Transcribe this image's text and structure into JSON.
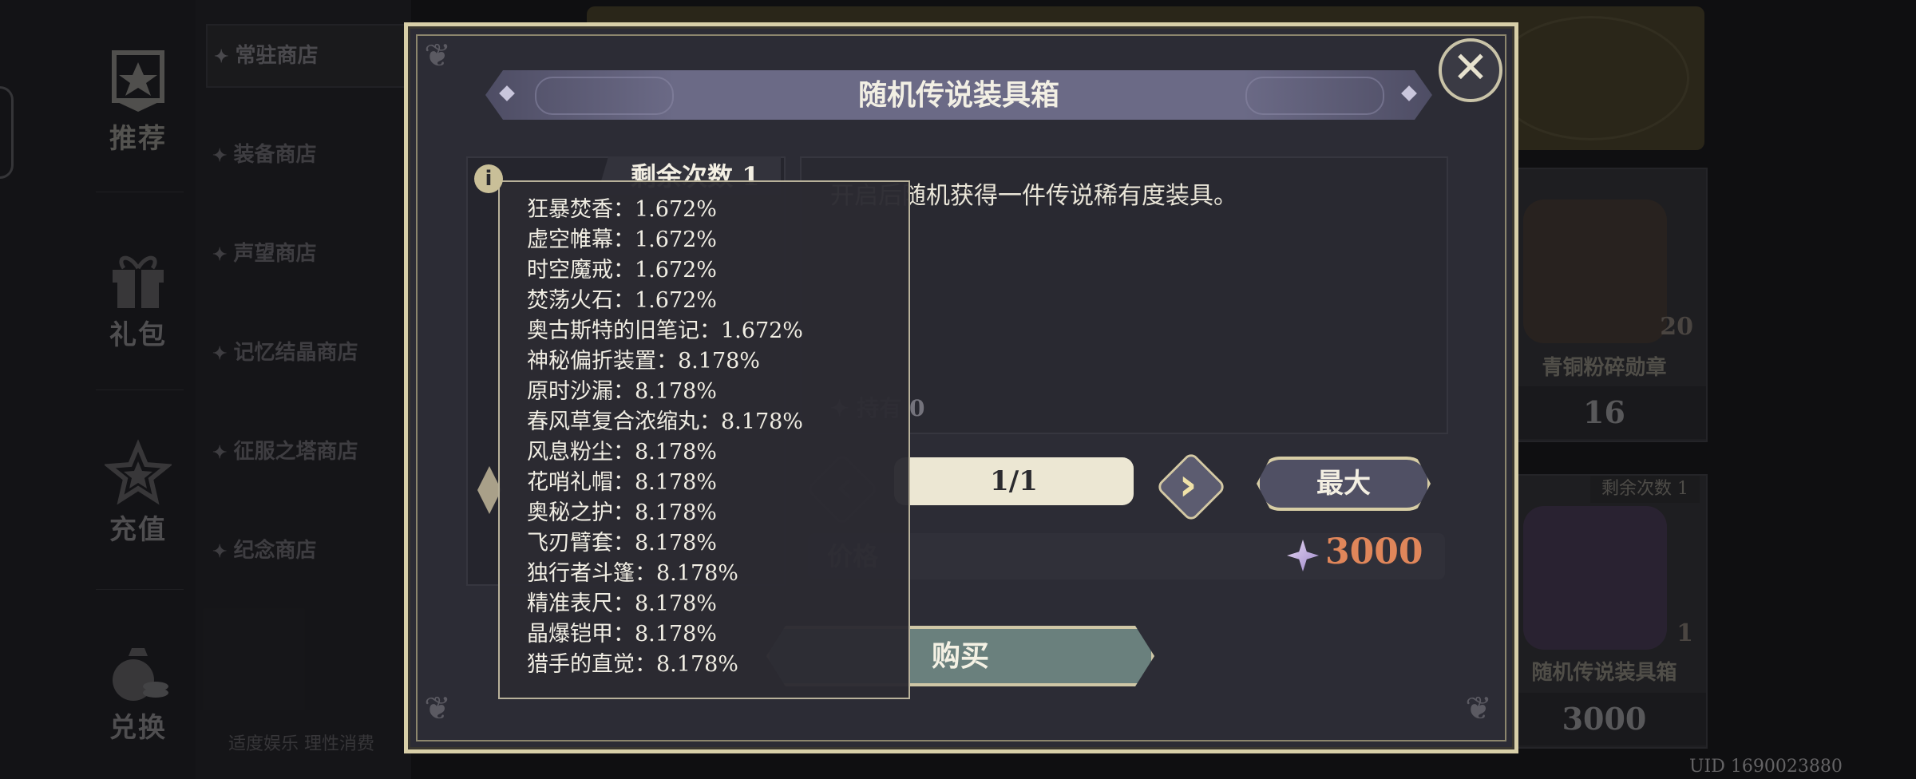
{
  "left_nav": {
    "items": [
      {
        "label": "推荐",
        "icon": "star-banner-icon"
      },
      {
        "label": "礼包",
        "icon": "gift-icon"
      },
      {
        "label": "充值",
        "icon": "star-sparkle-icon"
      },
      {
        "label": "兑换",
        "icon": "coin-bag-icon"
      }
    ]
  },
  "sub_menu": {
    "items": [
      "常驻商店",
      "装备商店",
      "声望商店",
      "记忆结晶商店",
      "征服之塔商店",
      "纪念商店"
    ]
  },
  "footer": {
    "notice": "适度娱乐 理性消费",
    "uid": "UID 1690023880"
  },
  "shop_cards": [
    {
      "name": "青铜粉碎勋章",
      "count": "20",
      "price": "16"
    },
    {
      "name": "随机传说装具箱",
      "count": "1",
      "price": "3000",
      "tag": "剩余次数  1"
    }
  ],
  "dialog": {
    "title": "随机传说装具箱",
    "remaining": "剩余次数  1",
    "description": "开启后随机获得一件传说稀有度装具。",
    "owned": "✦ 持有 0",
    "quantity": "1/1",
    "max_label": "最大",
    "price_label": "价格",
    "price_value": "3000",
    "buy_label": "购买",
    "close_symbol": "✕",
    "info_symbol": "i"
  },
  "probabilities": [
    "狂暴焚香：1.672%",
    "虚空帷幕：1.672%",
    "时空魔戒：1.672%",
    "焚荡火石：1.672%",
    "奥古斯特的旧笔记：1.672%",
    "神秘偏折装置：8.178%",
    "原时沙漏：8.178%",
    "春风草复合浓缩丸：8.178%",
    "风息粉尘：8.178%",
    "花哨礼帽：8.178%",
    "奥秘之护：8.178%",
    "飞刃臂套：8.178%",
    "独行者斗篷：8.178%",
    "精准表尺：8.178%",
    "晶爆铠甲：8.178%",
    "猎手的直觉：8.178%"
  ],
  "colors": {
    "dialog_bg": "#2c2c35",
    "gold_border": "#d8cfa8",
    "price_accent": "#e0865a",
    "buy_button": "#6a807d"
  }
}
